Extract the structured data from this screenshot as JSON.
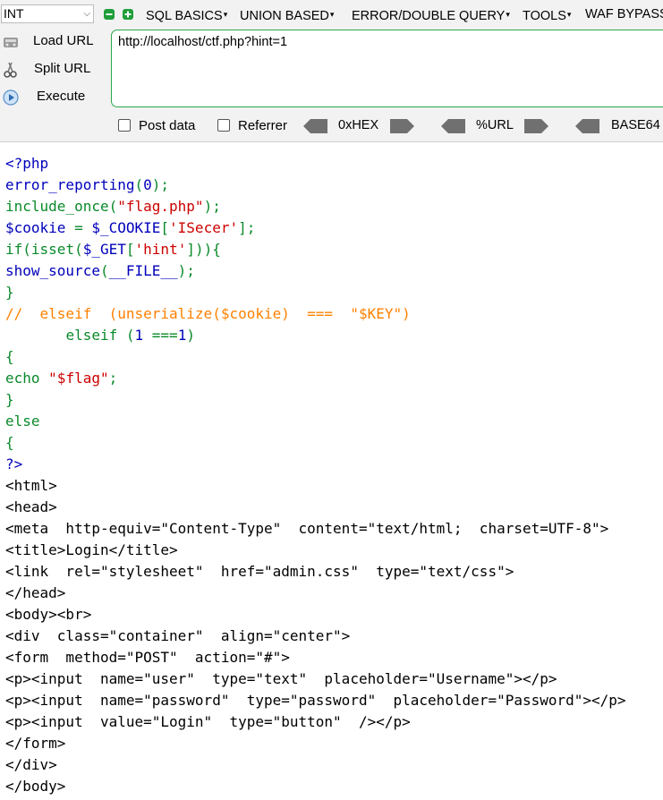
{
  "toolbar": {
    "select_value": "INT",
    "menu": {
      "sql_basics": "SQL BASICS",
      "union_based": "UNION BASED",
      "error_double": "ERROR/DOUBLE QUERY",
      "tools": "TOOLS",
      "waf_bypass": "WAF BYPASS"
    },
    "actions": {
      "load_url": "Load URL",
      "split_url": "Split URL",
      "execute": "Execute"
    },
    "url": "http://localhost/ctf.php?hint=1",
    "options": {
      "post_data": "Post data",
      "referrer": "Referrer"
    },
    "encoders": {
      "hex": "0xHEX",
      "url": "%URL",
      "base64": "BASE64"
    },
    "accent_green": "#2aa84a"
  },
  "source": {
    "lines": [
      [
        {
          "t": "<?php",
          "c": "def"
        }
      ],
      [
        {
          "t": "error_reporting",
          "c": "def"
        },
        {
          "t": "(",
          "c": "kw"
        },
        {
          "t": "0",
          "c": "def"
        },
        {
          "t": ");",
          "c": "kw"
        }
      ],
      [
        {
          "t": "include_once",
          "c": "kw"
        },
        {
          "t": "(",
          "c": "kw"
        },
        {
          "t": "\"flag.php\"",
          "c": "str"
        },
        {
          "t": ");",
          "c": "kw"
        }
      ],
      [
        {
          "t": "$cookie ",
          "c": "def"
        },
        {
          "t": "= ",
          "c": "kw"
        },
        {
          "t": "$_COOKIE",
          "c": "def"
        },
        {
          "t": "[",
          "c": "kw"
        },
        {
          "t": "'ISecer'",
          "c": "str"
        },
        {
          "t": "];",
          "c": "kw"
        }
      ],
      [
        {
          "t": "if",
          "c": "kw"
        },
        {
          "t": "(",
          "c": "kw"
        },
        {
          "t": "isset",
          "c": "kw"
        },
        {
          "t": "(",
          "c": "kw"
        },
        {
          "t": "$_GET",
          "c": "def"
        },
        {
          "t": "[",
          "c": "kw"
        },
        {
          "t": "'hint'",
          "c": "str"
        },
        {
          "t": "])){",
          "c": "kw"
        }
      ],
      [
        {
          "t": "show_source",
          "c": "def"
        },
        {
          "t": "(",
          "c": "kw"
        },
        {
          "t": "__FILE__",
          "c": "def"
        },
        {
          "t": ");",
          "c": "kw"
        }
      ],
      [
        {
          "t": "}",
          "c": "kw"
        }
      ],
      [
        {
          "t": "//  elseif  (unserialize($cookie)  ===  \"$KEY\")",
          "c": "cm"
        }
      ],
      [
        {
          "t": "       ",
          "c": "kw"
        },
        {
          "t": "elseif ",
          "c": "kw"
        },
        {
          "t": "(",
          "c": "kw"
        },
        {
          "t": "1 ",
          "c": "def"
        },
        {
          "t": "===",
          "c": "kw"
        },
        {
          "t": "1",
          "c": "def"
        },
        {
          "t": ")",
          "c": "kw"
        }
      ],
      [
        {
          "t": "{",
          "c": "kw"
        }
      ],
      [
        {
          "t": "echo ",
          "c": "kw"
        },
        {
          "t": "\"$flag\"",
          "c": "str"
        },
        {
          "t": ";",
          "c": "kw"
        }
      ],
      [
        {
          "t": "}",
          "c": "kw"
        }
      ],
      [
        {
          "t": "else",
          "c": "kw"
        }
      ],
      [
        {
          "t": "{",
          "c": "kw"
        }
      ],
      [
        {
          "t": "?>",
          "c": "def"
        }
      ],
      [
        {
          "t": "<html>",
          "c": "html"
        }
      ],
      [
        {
          "t": "<head>",
          "c": "html"
        }
      ],
      [
        {
          "t": "<meta  http-equiv=\"Content-Type\"  content=\"text/html;  charset=UTF-8\">",
          "c": "html"
        }
      ],
      [
        {
          "t": "<title>Login</title>",
          "c": "html"
        }
      ],
      [
        {
          "t": "<link  rel=\"stylesheet\"  href=\"admin.css\"  type=\"text/css\">",
          "c": "html"
        }
      ],
      [
        {
          "t": "</head>",
          "c": "html"
        }
      ],
      [
        {
          "t": "<body><br>",
          "c": "html"
        }
      ],
      [
        {
          "t": "<div  class=\"container\"  align=\"center\">",
          "c": "html"
        }
      ],
      [
        {
          "t": "<form  method=\"POST\"  action=\"#\">",
          "c": "html"
        }
      ],
      [
        {
          "t": "<p><input  name=\"user\"  type=\"text\"  placeholder=\"Username\"></p>",
          "c": "html"
        }
      ],
      [
        {
          "t": "<p><input  name=\"password\"  type=\"password\"  placeholder=\"Password\"></p>",
          "c": "html"
        }
      ],
      [
        {
          "t": "<p><input  value=\"Login\"  type=\"button\"  /></p>",
          "c": "html"
        }
      ],
      [
        {
          "t": "</form>",
          "c": "html"
        }
      ],
      [
        {
          "t": "</div>",
          "c": "html"
        }
      ],
      [
        {
          "t": "</body>",
          "c": "html"
        }
      ]
    ],
    "colors": {
      "keyword": "#0a8a2a",
      "default": "#0000bb",
      "string": "#cc0000",
      "comment": "#ff8000",
      "html": "#000000"
    }
  }
}
